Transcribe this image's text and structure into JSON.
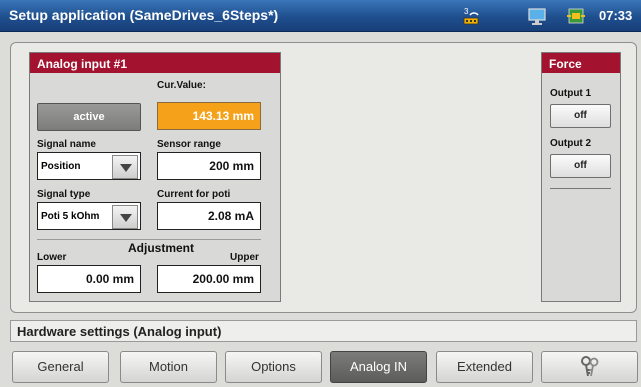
{
  "window": {
    "title": "Setup application (SameDrives_6Steps*)",
    "time": "07:33",
    "status_icons": [
      "signal-icon",
      "monitor-icon",
      "network-icon"
    ]
  },
  "analog_input": {
    "header": "Analog input #1",
    "active_button": "active",
    "cur_value_label": "Cur.Value:",
    "cur_value": "143.13 mm",
    "signal_name_label": "Signal name",
    "signal_name_value": "Position",
    "sensor_range_label": "Sensor range",
    "sensor_range_value": "200 mm",
    "signal_type_label": "Signal type",
    "signal_type_value": "Poti 5 kOhm",
    "current_for_poti_label": "Current for poti",
    "current_for_poti_value": "2.08 mA",
    "adjustment_label": "Adjustment",
    "lower_label": "Lower",
    "lower_value": "0.00 mm",
    "upper_label": "Upper",
    "upper_value": "200.00 mm"
  },
  "force": {
    "header": "Force",
    "output1_label": "Output 1",
    "output1_button": "off",
    "output2_label": "Output 2",
    "output2_button": "off"
  },
  "status": {
    "text": "Hardware settings (Analog input)"
  },
  "tabs": [
    {
      "label": "General"
    },
    {
      "label": "Motion"
    },
    {
      "label": "Options"
    },
    {
      "label": "Analog IN"
    },
    {
      "label": "Extended"
    },
    {
      "label": "",
      "icon": "keys-icon"
    }
  ],
  "colors": {
    "titlebar": "#1f4f8f",
    "group_header": "#a3122e",
    "current_value_bg": "#f5a21a",
    "selected_tab": "#6c6c6a"
  }
}
